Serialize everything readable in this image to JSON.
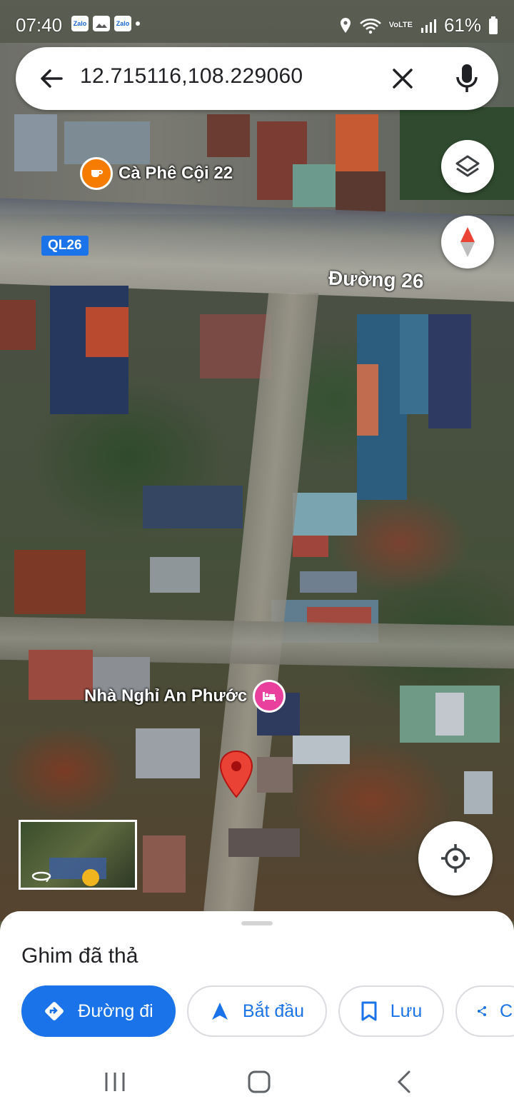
{
  "status_bar": {
    "time": "07:40",
    "left_icons": [
      "Zalo",
      "gallery",
      "Zalo"
    ],
    "volte": "VoLTE",
    "battery": "61%"
  },
  "search": {
    "query": "12.715116,108.229060",
    "back_icon": "arrow-left-icon",
    "clear_icon": "close-icon",
    "mic_icon": "mic-icon"
  },
  "map": {
    "road_shield": "QL26",
    "road_name": "Đường 26",
    "places": [
      {
        "name": "Cà Phê Cội 22",
        "type": "cafe",
        "color": "#f57c00"
      },
      {
        "name": "Nhà Nghỉ An Phước",
        "type": "hotel",
        "color": "#e8409c"
      }
    ],
    "dropped_pin_color": "#ea4335"
  },
  "sheet": {
    "title": "Ghim đã thả",
    "actions": [
      {
        "label": "Đường đi",
        "icon": "directions-icon"
      },
      {
        "label": "Bắt đầu",
        "icon": "navigation-arrow-icon"
      },
      {
        "label": "Lưu",
        "icon": "bookmark-icon"
      },
      {
        "label": "C",
        "icon": "share-icon"
      }
    ]
  },
  "colors": {
    "accent": "#1a73e8"
  }
}
